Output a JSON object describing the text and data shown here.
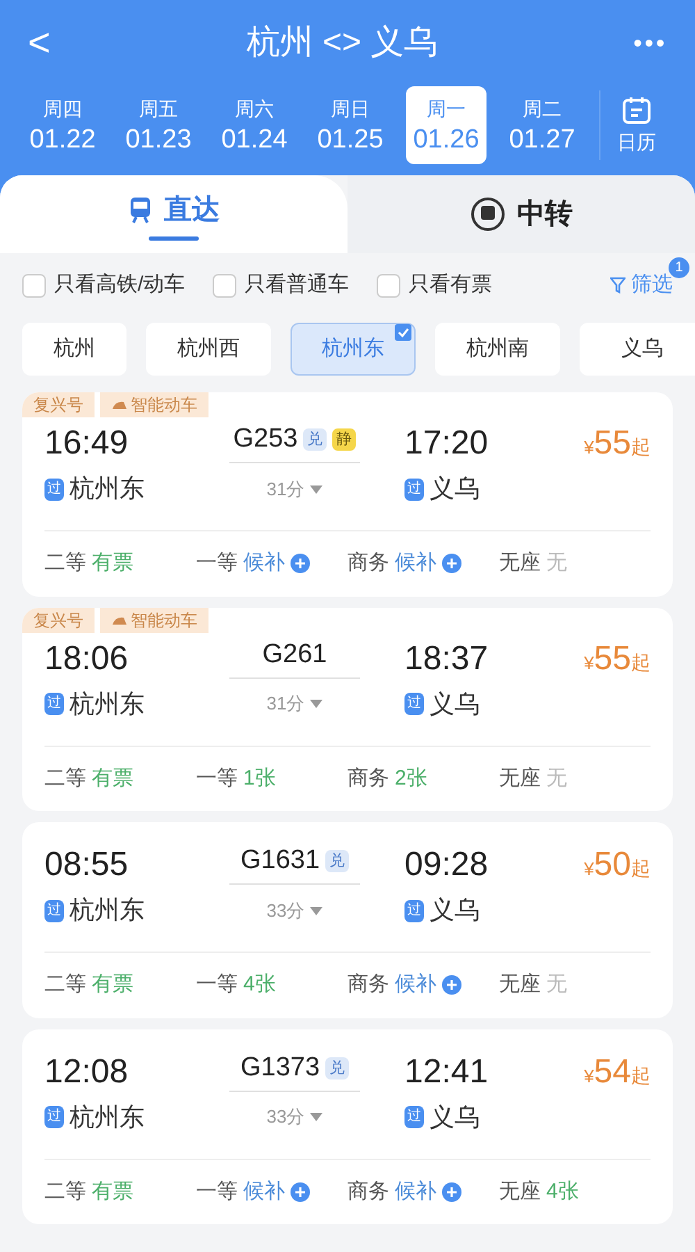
{
  "header": {
    "back": "<",
    "title": "杭州 <> 义乌",
    "more": "•••"
  },
  "dates": [
    {
      "weekday": "周四",
      "date": "01.22",
      "selected": false
    },
    {
      "weekday": "周五",
      "date": "01.23",
      "selected": false
    },
    {
      "weekday": "周六",
      "date": "01.24",
      "selected": false
    },
    {
      "weekday": "周日",
      "date": "01.25",
      "selected": false
    },
    {
      "weekday": "周一",
      "date": "01.26",
      "selected": true
    },
    {
      "weekday": "周二",
      "date": "01.27",
      "selected": false
    }
  ],
  "calendar_label": "日历",
  "modes": [
    {
      "label": "直达",
      "selected": true
    },
    {
      "label": "中转",
      "selected": false
    }
  ],
  "filters": [
    {
      "label": "只看高铁/动车",
      "checked": false
    },
    {
      "label": "只看普通车",
      "checked": false
    },
    {
      "label": "只看有票",
      "checked": false
    }
  ],
  "screen": {
    "label": "筛选",
    "badge": "1"
  },
  "stations": [
    {
      "label": "杭州",
      "selected": false
    },
    {
      "label": "杭州西",
      "selected": false
    },
    {
      "label": "杭州东",
      "selected": true
    },
    {
      "label": "杭州南",
      "selected": false
    },
    {
      "label": "义乌",
      "selected": false
    }
  ],
  "trains": [
    {
      "tags": [
        "复兴号",
        "智能动车"
      ],
      "depart": "16:49",
      "train": "G253",
      "badges": [
        {
          "text": "兑",
          "kind": "exchange"
        },
        {
          "text": "静",
          "kind": "quiet"
        }
      ],
      "arrive": "17:20",
      "from_mark": "过",
      "from": "杭州东",
      "duration": "31分",
      "to_mark": "过",
      "to": "义乌",
      "price_symbol": "¥",
      "price": "55",
      "price_suffix": "起",
      "seats": [
        {
          "label": "二等",
          "status": "有票",
          "kind": "available"
        },
        {
          "label": "一等",
          "status": "候补",
          "kind": "waitlist"
        },
        {
          "label": "商务",
          "status": "候补",
          "kind": "waitlist"
        },
        {
          "label": "无座",
          "status": "无",
          "kind": "none"
        }
      ]
    },
    {
      "tags": [
        "复兴号",
        "智能动车"
      ],
      "depart": "18:06",
      "train": "G261",
      "arrive": "18:37",
      "from_mark": "过",
      "from": "杭州东",
      "duration": "31分",
      "to_mark": "过",
      "to": "义乌",
      "price_symbol": "¥",
      "price": "55",
      "price_suffix": "起",
      "seats": [
        {
          "label": "二等",
          "status": "有票",
          "kind": "available"
        },
        {
          "label": "一等",
          "status": "1张",
          "kind": "available"
        },
        {
          "label": "商务",
          "status": "2张",
          "kind": "available"
        },
        {
          "label": "无座",
          "status": "无",
          "kind": "none"
        }
      ]
    },
    {
      "depart": "08:55",
      "train": "G1631",
      "badges": [
        {
          "text": "兑",
          "kind": "exchange"
        }
      ],
      "arrive": "09:28",
      "from_mark": "过",
      "from": "杭州东",
      "duration": "33分",
      "to_mark": "过",
      "to": "义乌",
      "price_symbol": "¥",
      "price": "50",
      "price_suffix": "起",
      "seats": [
        {
          "label": "二等",
          "status": "有票",
          "kind": "available"
        },
        {
          "label": "一等",
          "status": "4张",
          "kind": "available"
        },
        {
          "label": "商务",
          "status": "候补",
          "kind": "waitlist"
        },
        {
          "label": "无座",
          "status": "无",
          "kind": "none"
        }
      ]
    },
    {
      "depart": "12:08",
      "train": "G1373",
      "badges": [
        {
          "text": "兑",
          "kind": "exchange"
        }
      ],
      "arrive": "12:41",
      "from_mark": "过",
      "from": "杭州东",
      "duration": "33分",
      "to_mark": "过",
      "to": "义乌",
      "price_symbol": "¥",
      "price": "54",
      "price_suffix": "起",
      "seats": [
        {
          "label": "二等",
          "status": "有票",
          "kind": "available"
        },
        {
          "label": "一等",
          "status": "候补",
          "kind": "waitlist"
        },
        {
          "label": "商务",
          "status": "候补",
          "kind": "waitlist"
        },
        {
          "label": "无座",
          "status": "4张",
          "kind": "available"
        }
      ]
    }
  ]
}
